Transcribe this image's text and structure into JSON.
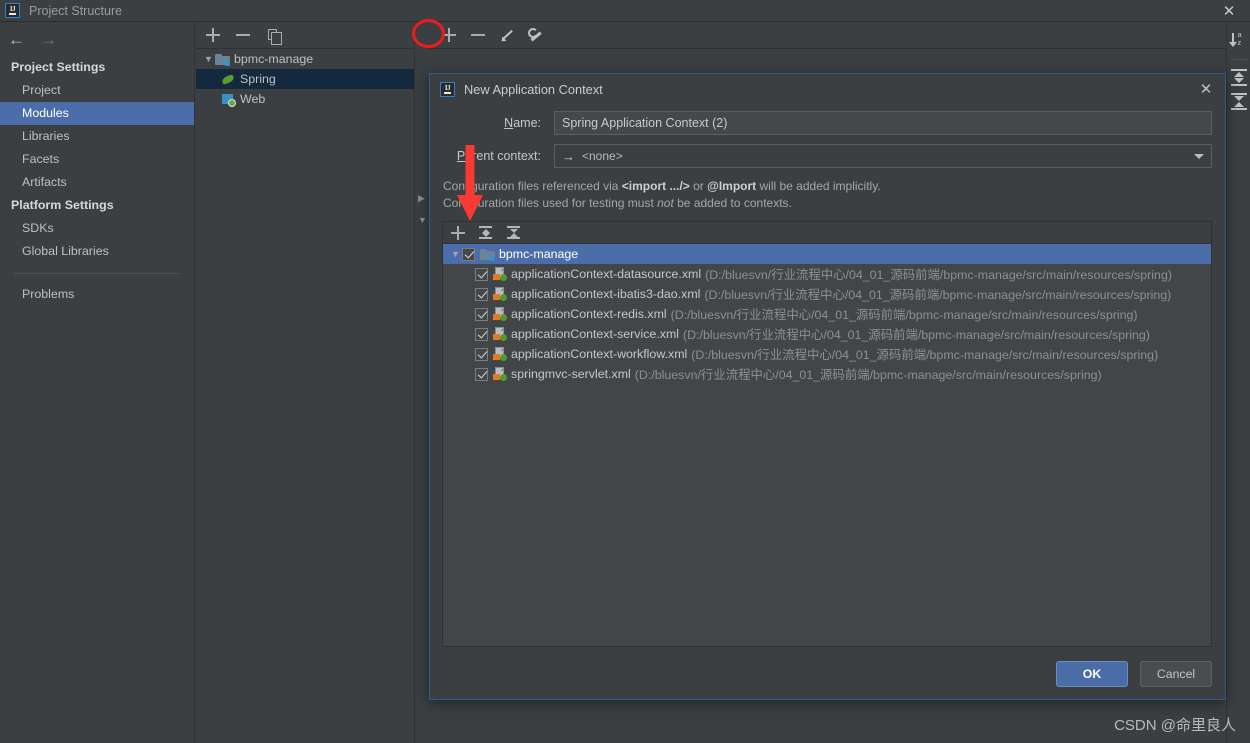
{
  "window": {
    "title": "Project Structure",
    "close_label": "✕",
    "logo_text": "IJ"
  },
  "sidebar": {
    "nav": {
      "back": "←",
      "forward": "→"
    },
    "groups": [
      {
        "header": "Project Settings",
        "items": [
          {
            "label": "Project",
            "selected": false
          },
          {
            "label": "Modules",
            "selected": true
          },
          {
            "label": "Libraries",
            "selected": false
          },
          {
            "label": "Facets",
            "selected": false
          },
          {
            "label": "Artifacts",
            "selected": false
          }
        ]
      },
      {
        "header": "Platform Settings",
        "items": [
          {
            "label": "SDKs",
            "selected": false
          },
          {
            "label": "Global Libraries",
            "selected": false
          }
        ]
      }
    ],
    "footer_item": "Problems"
  },
  "module_panel": {
    "toolbar": [
      {
        "name": "add-module-button",
        "label": "+"
      },
      {
        "name": "remove-module-button",
        "label": "−"
      },
      {
        "name": "copy-module-button",
        "label": "copy"
      }
    ],
    "tree": [
      {
        "label": "bpmc-manage",
        "icon": "folder-icon",
        "expanded": true,
        "level": 0,
        "selected": false
      },
      {
        "label": "Spring",
        "icon": "spring-leaf-icon",
        "level": 1,
        "selected": true
      },
      {
        "label": "Web",
        "icon": "web-icon",
        "level": 1,
        "selected": false
      }
    ]
  },
  "right_toolbar": [
    {
      "name": "add-context-button",
      "label": "+",
      "highlighted": true
    },
    {
      "name": "remove-context-button",
      "label": "−"
    },
    {
      "name": "edit-context-button",
      "label": "pencil-icon"
    },
    {
      "name": "configure-button",
      "label": "wrench-icon"
    }
  ],
  "far_toolbar": [
    {
      "name": "sort-alphabetically-icon",
      "label": "↓az"
    },
    {
      "name": "expand-all-icon",
      "label": "expand-all"
    },
    {
      "name": "collapse-all-icon",
      "label": "collapse-all"
    }
  ],
  "dialog": {
    "title": "New Application Context",
    "close_label": "✕",
    "name_label": "Name:",
    "name_mnemonic": "N",
    "name_value": "Spring Application Context (2)",
    "name_placeholder": "Spring Application Context",
    "parent_label": "Parent context:",
    "parent_mnemonic": "P",
    "parent_value": "<none>",
    "parent_arrow": "→",
    "hint_line1_a": "Configuration files referenced via ",
    "hint_line1_b": "<import .../>",
    "hint_line1_c": " or ",
    "hint_line1_d": "@Import",
    "hint_line1_e": " will be added implicitly.",
    "hint_line2_a": "Configuration files used for testing must ",
    "hint_line2_b": "not",
    "hint_line2_c": " be added to contexts.",
    "list_toolbar": [
      {
        "name": "add-file-button",
        "label": "+"
      },
      {
        "name": "expand-all-button",
        "label": "expand-all"
      },
      {
        "name": "collapse-all-button",
        "label": "collapse-all"
      }
    ],
    "files": {
      "root": {
        "label": "bpmc-manage",
        "checked": true,
        "expanded": true
      },
      "items": [
        {
          "label": "applicationContext-datasource.xml",
          "path": "(D:/bluesvn/行业流程中心/04_01_源码前端/bpmc-manage/src/main/resources/spring)",
          "checked": true
        },
        {
          "label": "applicationContext-ibatis3-dao.xml",
          "path": "(D:/bluesvn/行业流程中心/04_01_源码前端/bpmc-manage/src/main/resources/spring)",
          "checked": true
        },
        {
          "label": "applicationContext-redis.xml",
          "path": "(D:/bluesvn/行业流程中心/04_01_源码前端/bpmc-manage/src/main/resources/spring)",
          "checked": true
        },
        {
          "label": "applicationContext-service.xml",
          "path": "(D:/bluesvn/行业流程中心/04_01_源码前端/bpmc-manage/src/main/resources/spring)",
          "checked": true
        },
        {
          "label": "applicationContext-workflow.xml",
          "path": "(D:/bluesvn/行业流程中心/04_01_源码前端/bpmc-manage/src/main/resources/spring)",
          "checked": true
        },
        {
          "label": "springmvc-servlet.xml",
          "path": "(D:/bluesvn/行业流程中心/04_01_源码前端/bpmc-manage/src/main/resources/spring)",
          "checked": true
        }
      ]
    },
    "ok_label": "OK",
    "cancel_label": "Cancel"
  },
  "annotations": {
    "circle_target": "add-context-button",
    "arrow_target": "add-file-button",
    "color": "#f01c1c"
  },
  "watermark": "CSDN @命里良人",
  "colors": {
    "background": "#3c3f41",
    "selection_blue": "#4b6eab",
    "selection_unfocused": "#13293d",
    "list_background": "#434649",
    "accent_red": "#f01c1c"
  }
}
